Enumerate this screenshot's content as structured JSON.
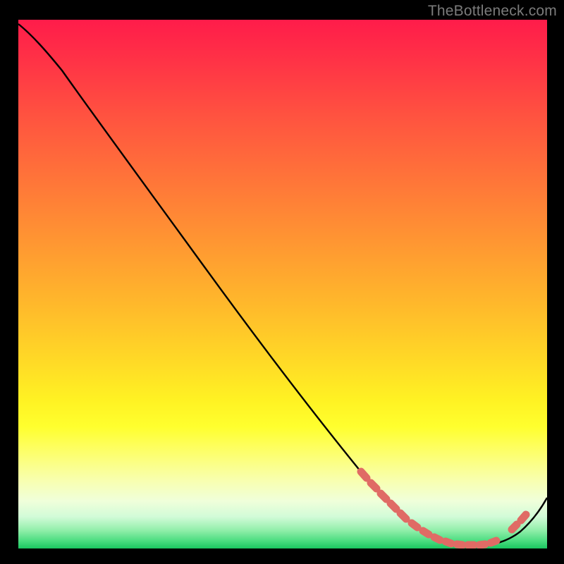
{
  "watermark": "TheBottleneck.com",
  "chart_data": {
    "type": "line",
    "title": "",
    "xlabel": "",
    "ylabel": "",
    "xlim": [
      0,
      100
    ],
    "ylim": [
      0,
      100
    ],
    "note": "Bottleneck-style curve: steep descent from top-left, flat valley near x≈72–92, rise at far right. Background is a vertical heat gradient red→yellow→green.",
    "curve": [
      {
        "x": 0,
        "y": 99
      },
      {
        "x": 4,
        "y": 96.5
      },
      {
        "x": 8,
        "y": 92
      },
      {
        "x": 14,
        "y": 84
      },
      {
        "x": 22,
        "y": 73
      },
      {
        "x": 32,
        "y": 59
      },
      {
        "x": 42,
        "y": 45
      },
      {
        "x": 52,
        "y": 31
      },
      {
        "x": 60,
        "y": 20
      },
      {
        "x": 66,
        "y": 12
      },
      {
        "x": 72,
        "y": 5
      },
      {
        "x": 78,
        "y": 2
      },
      {
        "x": 84,
        "y": 1.2
      },
      {
        "x": 90,
        "y": 2
      },
      {
        "x": 95,
        "y": 5
      },
      {
        "x": 100,
        "y": 11
      }
    ],
    "highlight_segments": [
      {
        "x0": 64,
        "x1": 73,
        "note": "descending thick salmon dashes"
      },
      {
        "x0": 73,
        "x1": 91,
        "note": "valley thick salmon dashes"
      },
      {
        "x0": 92,
        "x1": 95,
        "note": "ascending short salmon dash"
      }
    ],
    "colors": {
      "curve": "#000000",
      "highlight": "#e06b65",
      "gradient_top": "#ff1c4a",
      "gradient_mid": "#ffdb26",
      "gradient_bottom": "#1ac65f",
      "background": "#000000",
      "watermark": "#7b7b7b"
    }
  }
}
